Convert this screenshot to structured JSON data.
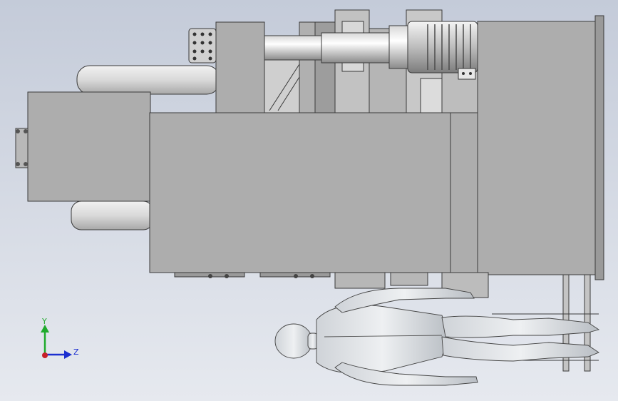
{
  "viewport": {
    "background_top": "#c4cbd9",
    "background_bottom": "#e6e9ef"
  },
  "triad": {
    "y_label": "Y",
    "z_label": "Z",
    "y_color": "#1faa2c",
    "z_color": "#1c2fd0",
    "x_color": "#c8202a"
  },
  "model": {
    "part_fill": "#adadad",
    "part_dark": "#8f8f8f",
    "edge_color": "#3a3a3a",
    "figure_fill": "#d4d8dc"
  }
}
